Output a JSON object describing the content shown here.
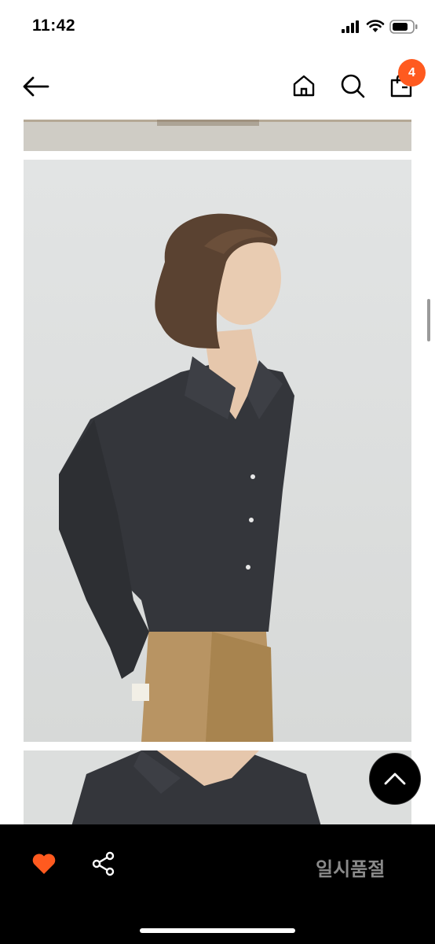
{
  "status_bar": {
    "time": "11:42"
  },
  "nav": {
    "cart_count": "4"
  },
  "bottom_bar": {
    "status_label": "일시품절"
  },
  "colors": {
    "accent": "#ff5a1f",
    "bar_bg": "#000000",
    "status_text": "#8a8a8a"
  },
  "icons": {
    "back": "arrow-left-icon",
    "home": "home-icon",
    "search": "search-icon",
    "cart": "shopping-bag-icon",
    "like": "heart-icon",
    "share": "share-icon",
    "scroll_top": "chevron-up-icon"
  }
}
